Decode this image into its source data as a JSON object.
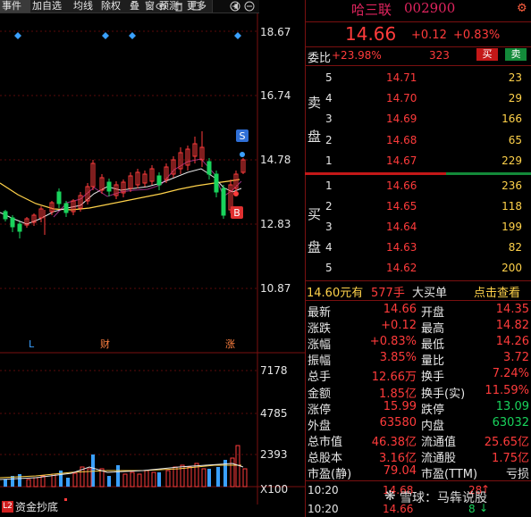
{
  "toolbar": {
    "items": [
      "事件",
      "加自选",
      "均线",
      "除权",
      "叠",
      "窗",
      "预测",
      "更多"
    ],
    "icons": [
      "eye-icon",
      "trash-icon",
      "expand-icon",
      "zoom-in-icon",
      "zoom-out-icon"
    ]
  },
  "chart": {
    "price_axis": [
      "18.67",
      "16.74",
      "14.78",
      "12.83",
      "10.87"
    ],
    "volume_axis": [
      "7178",
      "4785",
      "2393",
      "X100"
    ],
    "markers": {
      "low_label": "L",
      "fin_label": "财",
      "zhang_label": "涨",
      "sell_flag": "S",
      "buy_flag": "B"
    },
    "bottom_tab": {
      "badge": "L2",
      "label": "资金抄底"
    }
  },
  "header": {
    "name": "哈三联",
    "code": "002900",
    "price": "14.66",
    "change": "+0.12",
    "change_pct": "+0.83%"
  },
  "committee": {
    "label": "委比",
    "ratio": "+23.98%",
    "diff": "323",
    "sell_btn": "买",
    "buy_btn": "卖"
  },
  "sell_side": {
    "label": [
      "卖",
      "盘"
    ],
    "rows": [
      {
        "lvl": "5",
        "price": "14.71",
        "vol": "23"
      },
      {
        "lvl": "4",
        "price": "14.70",
        "vol": "29"
      },
      {
        "lvl": "3",
        "price": "14.69",
        "vol": "166"
      },
      {
        "lvl": "2",
        "price": "14.68",
        "vol": "65"
      },
      {
        "lvl": "1",
        "price": "14.67",
        "vol": "229"
      }
    ]
  },
  "buy_side": {
    "label": [
      "买",
      "盘"
    ],
    "rows": [
      {
        "lvl": "1",
        "price": "14.66",
        "vol": "236"
      },
      {
        "lvl": "2",
        "price": "14.65",
        "vol": "118"
      },
      {
        "lvl": "3",
        "price": "14.64",
        "vol": "199"
      },
      {
        "lvl": "4",
        "price": "14.63",
        "vol": "82"
      },
      {
        "lvl": "5",
        "price": "14.62",
        "vol": "200"
      }
    ]
  },
  "big_order": {
    "price": "14.60元有",
    "qty": "577手",
    "desc": "大买单",
    "link": "点击查看"
  },
  "stats": [
    {
      "l": "最新",
      "lv": "14.66",
      "r": "开盘",
      "rv": "14.35"
    },
    {
      "l": "涨跌",
      "lv": "+0.12",
      "r": "最高",
      "rv": "14.82"
    },
    {
      "l": "涨幅",
      "lv": "+0.83%",
      "r": "最低",
      "rv": "14.26"
    },
    {
      "l": "振幅",
      "lv": "3.85%",
      "r": "量比",
      "rv": "3.72"
    },
    {
      "l": "总手",
      "lv": "12.66万",
      "r": "换手",
      "rv": "7.24%"
    },
    {
      "l": "金额",
      "lv": "1.85亿",
      "r": "换手(实)",
      "rv": "11.59%"
    },
    {
      "l": "涨停",
      "lv": "15.99",
      "r": "跌停",
      "rv": "13.09"
    },
    {
      "l": "外盘",
      "lv": "63580",
      "r": "内盘",
      "rv": "63032"
    },
    {
      "l": "总市值",
      "lv": "46.38亿",
      "r": "流通值",
      "rv": "25.65亿"
    },
    {
      "l": "总股本",
      "lv": "3.16亿",
      "r": "流通股",
      "rv": "1.75亿"
    },
    {
      "l": "市盈(静)",
      "lv": "79.04",
      "r": "市盈(TTM)",
      "rv": "亏损"
    }
  ],
  "ticks": [
    {
      "time": "10:20",
      "price": "14.68",
      "vol": "28"
    },
    {
      "time": "10:20",
      "price": "14.66",
      "vol": "8"
    }
  ],
  "watermark": "雪球：马犇说股",
  "colors": {
    "up": "#ff3b3b",
    "down": "#19d35c",
    "grid": "#7a1010",
    "ma5": "#e8e8e8",
    "ma10": "#ffd24a",
    "ma20": "#ff4fd8"
  }
}
